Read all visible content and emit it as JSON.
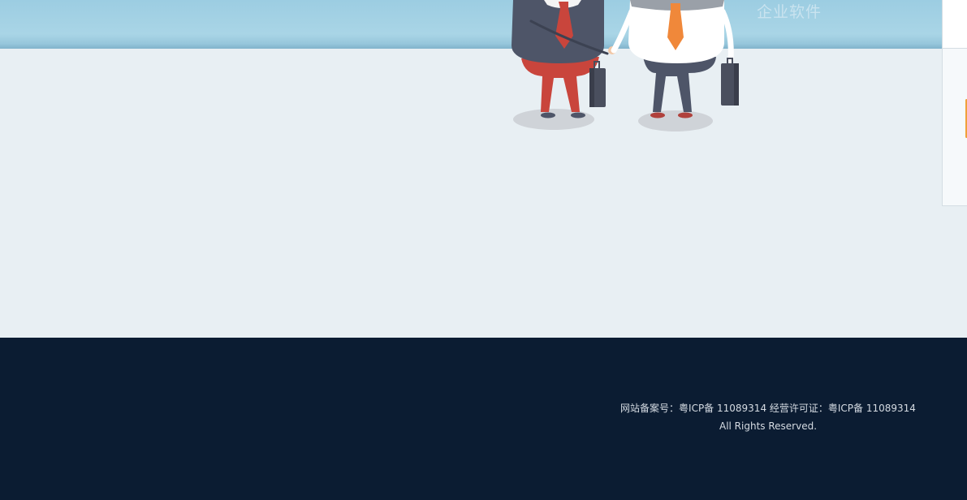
{
  "banner": {
    "tagline": "企业软件",
    "colors": {
      "sky": "#9ccde2",
      "page_bg": "#e8eff3"
    }
  },
  "illustration": {
    "icon": "businessmen-handshake-illustration",
    "colors": {
      "left_suit": "#4e5568",
      "left_pants": "#c9453c",
      "left_tie": "#c9453c",
      "right_shirt": "#ffffff",
      "right_tie": "#f0883a",
      "right_pants": "#4e5568",
      "briefcase": "#4a4f5e",
      "shadow": "#cfd3d8"
    }
  },
  "side_panel": {
    "accent_color": "#f0a03a"
  },
  "footer": {
    "record_line": "网站备案号：粤ICP备 11089314 经营许可证：粤ICP备 11089314",
    "rights_line": "All Rights Reserved.",
    "bg_color": "#0b1c32"
  }
}
